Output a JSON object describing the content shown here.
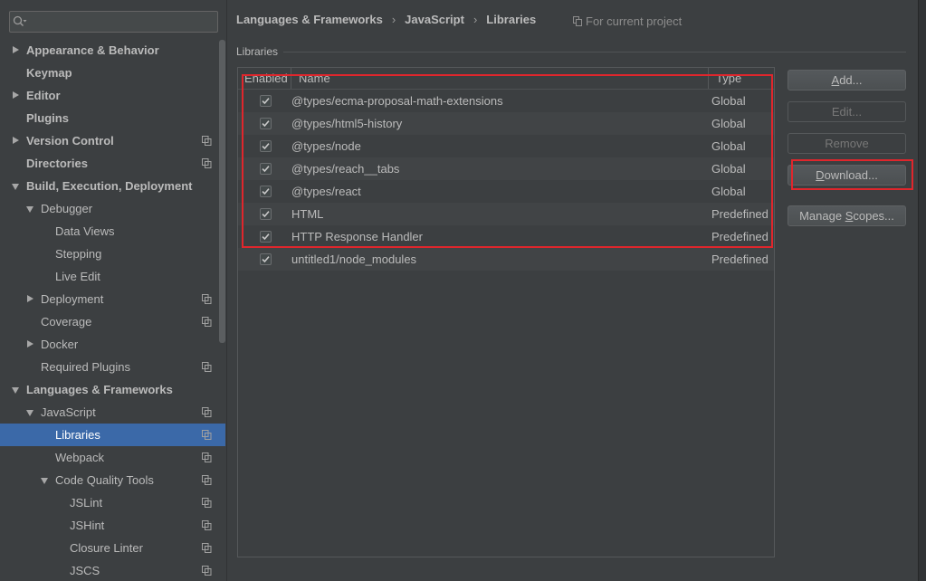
{
  "colors": {
    "background": "#3c3f41",
    "text": "#bbbbbb",
    "selection": "#3b69a8",
    "annotation": "#e0262c"
  },
  "sidebar": {
    "search": {
      "value": "",
      "placeholder": ""
    },
    "tree": [
      {
        "label": "Appearance & Behavior",
        "state": "collapsed"
      },
      {
        "label": "Keymap",
        "state": "leaf"
      },
      {
        "label": "Editor",
        "state": "collapsed"
      },
      {
        "label": "Plugins",
        "state": "leaf"
      },
      {
        "label": "Version Control",
        "state": "collapsed",
        "project_scoped": true
      },
      {
        "label": "Directories",
        "state": "leaf",
        "project_scoped": true
      },
      {
        "label": "Build, Execution, Deployment",
        "state": "expanded",
        "children": [
          {
            "label": "Debugger",
            "state": "expanded",
            "children": [
              {
                "label": "Data Views",
                "state": "leaf"
              },
              {
                "label": "Stepping",
                "state": "leaf"
              },
              {
                "label": "Live Edit",
                "state": "leaf"
              }
            ]
          },
          {
            "label": "Deployment",
            "state": "collapsed",
            "project_scoped": true
          },
          {
            "label": "Coverage",
            "state": "leaf",
            "project_scoped": true
          },
          {
            "label": "Docker",
            "state": "collapsed"
          },
          {
            "label": "Required Plugins",
            "state": "leaf",
            "project_scoped": true
          }
        ]
      },
      {
        "label": "Languages & Frameworks",
        "state": "expanded",
        "children": [
          {
            "label": "JavaScript",
            "state": "expanded",
            "project_scoped": true,
            "children": [
              {
                "label": "Libraries",
                "state": "leaf",
                "project_scoped": true,
                "selected": true
              },
              {
                "label": "Webpack",
                "state": "leaf",
                "project_scoped": true
              },
              {
                "label": "Code Quality Tools",
                "state": "expanded",
                "project_scoped": true,
                "children": [
                  {
                    "label": "JSLint",
                    "state": "leaf",
                    "project_scoped": true
                  },
                  {
                    "label": "JSHint",
                    "state": "leaf",
                    "project_scoped": true
                  },
                  {
                    "label": "Closure Linter",
                    "state": "leaf",
                    "project_scoped": true
                  },
                  {
                    "label": "JSCS",
                    "state": "leaf",
                    "project_scoped": true
                  }
                ]
              }
            ]
          }
        ]
      }
    ]
  },
  "header": {
    "breadcrumb": [
      "Languages & Frameworks",
      "JavaScript",
      "Libraries"
    ],
    "separator": "›",
    "scope_note": "For current project",
    "scope_icon": "project-level-icon"
  },
  "libraries": {
    "section_label": "Libraries",
    "columns": {
      "enabled": "Enabled",
      "name": "Name",
      "type": "Type"
    },
    "rows": [
      {
        "enabled": true,
        "name": "@types/ecma-proposal-math-extensions",
        "type": "Global"
      },
      {
        "enabled": true,
        "name": "@types/html5-history",
        "type": "Global"
      },
      {
        "enabled": true,
        "name": "@types/node",
        "type": "Global"
      },
      {
        "enabled": true,
        "name": "@types/reach__tabs",
        "type": "Global"
      },
      {
        "enabled": true,
        "name": "@types/react",
        "type": "Global"
      },
      {
        "enabled": true,
        "name": "HTML",
        "type": "Predefined"
      },
      {
        "enabled": true,
        "name": "HTTP Response Handler",
        "type": "Predefined"
      },
      {
        "enabled": true,
        "name": "untitled1/node_modules",
        "type": "Predefined"
      }
    ]
  },
  "actions": {
    "add": {
      "label": "Add...",
      "mnemonic": "A",
      "enabled": true
    },
    "edit": {
      "label": "Edit...",
      "enabled": false
    },
    "remove": {
      "label": "Remove",
      "enabled": false
    },
    "download": {
      "label": "Download...",
      "mnemonic": "D",
      "enabled": true
    },
    "manage_scopes": {
      "label": "Manage Scopes...",
      "mnemonic": "S",
      "enabled": true
    }
  }
}
